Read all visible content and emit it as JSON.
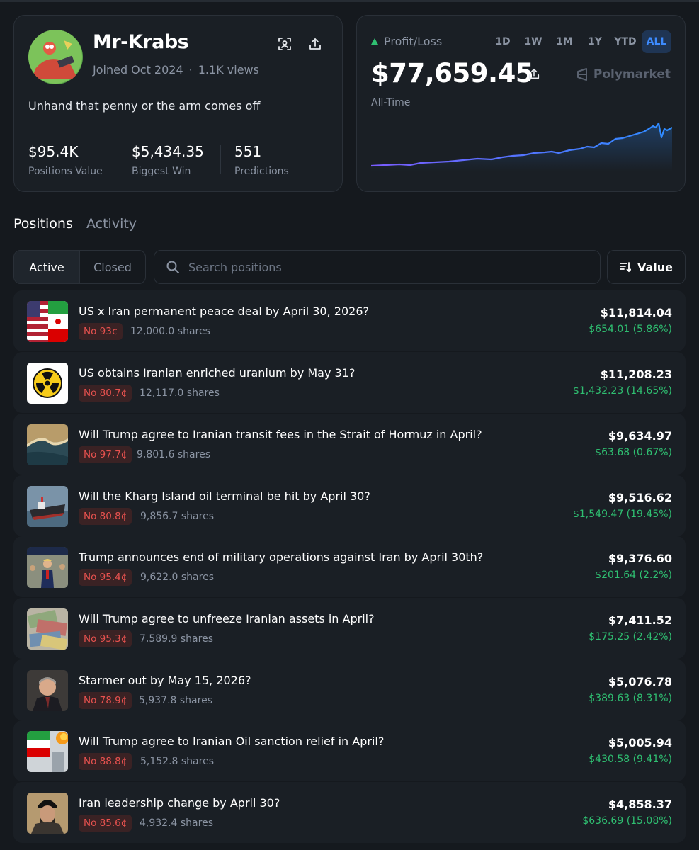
{
  "profile": {
    "username": "Mr-Krabs",
    "joined": "Joined Oct 2024",
    "views": "1.1K views",
    "bio": "Unhand that penny or the arm comes off",
    "stats": [
      {
        "value": "$95.4K",
        "label": "Positions Value"
      },
      {
        "value": "$5,434.35",
        "label": "Biggest Win"
      },
      {
        "value": "551",
        "label": "Predictions"
      }
    ]
  },
  "pnl": {
    "label": "Profit/Loss",
    "value": "$77,659.45",
    "period": "All-Time",
    "brand": "Polymarket",
    "timeframes": [
      "1D",
      "1W",
      "1M",
      "1Y",
      "YTD",
      "ALL"
    ],
    "active_timeframe": "ALL"
  },
  "tabs": {
    "positions": "Positions",
    "activity": "Activity"
  },
  "filters": {
    "active": "Active",
    "closed": "Closed"
  },
  "search": {
    "placeholder": "Search positions"
  },
  "sort": {
    "label": "Value"
  },
  "positions": [
    {
      "title": "US x Iran permanent peace deal by April 30, 2026?",
      "outcome": "No 93¢",
      "shares": "12,000.0 shares",
      "value": "$11,814.04",
      "change": "$654.01 (5.86%)",
      "thumb": "us-iran-flags"
    },
    {
      "title": "US obtains Iranian enriched uranium by May 31?",
      "outcome": "No 80.7¢",
      "shares": "12,117.0 shares",
      "value": "$11,208.23",
      "change": "$1,432.23 (14.65%)",
      "thumb": "radiation"
    },
    {
      "title": "Will Trump agree to Iranian transit fees in the Strait of Hormuz in April?",
      "outcome": "No 97.7¢",
      "shares": "9,801.6 shares",
      "value": "$9,634.97",
      "change": "$63.68 (0.67%)",
      "thumb": "satellite"
    },
    {
      "title": "Will the Kharg Island oil terminal be hit by April 30?",
      "outcome": "No 80.8¢",
      "shares": "9,856.7 shares",
      "value": "$9,516.62",
      "change": "$1,549.47 (19.45%)",
      "thumb": "tanker"
    },
    {
      "title": "Trump announces end of military operations against Iran by April 30th?",
      "outcome": "No 95.4¢",
      "shares": "9,622.0 shares",
      "value": "$9,376.60",
      "change": "$201.64 (2.2%)",
      "thumb": "trump"
    },
    {
      "title": "Will Trump agree to unfreeze Iranian assets in April?",
      "outcome": "No 95.3¢",
      "shares": "7,589.9 shares",
      "value": "$7,411.52",
      "change": "$175.25 (2.42%)",
      "thumb": "cash"
    },
    {
      "title": "Starmer out by May 15, 2026?",
      "outcome": "No 78.9¢",
      "shares": "5,937.8 shares",
      "value": "$5,076.78",
      "change": "$389.63 (8.31%)",
      "thumb": "starmer"
    },
    {
      "title": "Will Trump agree to Iranian Oil sanction relief in April?",
      "outcome": "No 88.8¢",
      "shares": "5,152.8 shares",
      "value": "$5,005.94",
      "change": "$430.58 (9.41%)",
      "thumb": "oil-flag"
    },
    {
      "title": "Iran leadership change by April 30?",
      "outcome": "No 85.6¢",
      "shares": "4,932.4 shares",
      "value": "$4,858.37",
      "change": "$636.69 (15.08%)",
      "thumb": "cleric"
    }
  ],
  "colors": {
    "profit": "#2fbf71",
    "loss_badge": "#e8524f",
    "accent": "#3d8bff"
  }
}
